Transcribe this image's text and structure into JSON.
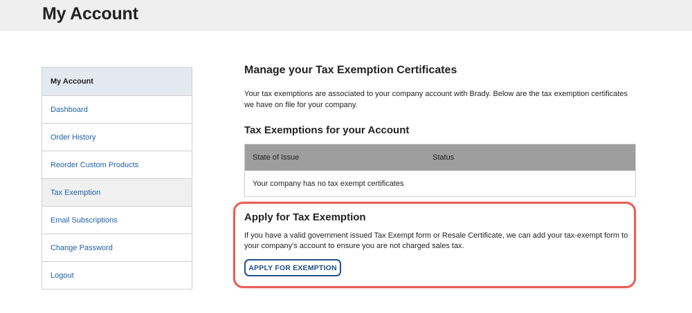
{
  "header": {
    "title": "My Account"
  },
  "sidebar": {
    "items": [
      {
        "label": "My Account"
      },
      {
        "label": "Dashboard"
      },
      {
        "label": "Order History"
      },
      {
        "label": "Reorder Custom Products"
      },
      {
        "label": "Tax Exemption"
      },
      {
        "label": "Email Subscriptions"
      },
      {
        "label": "Change Password"
      },
      {
        "label": "Logout"
      }
    ]
  },
  "main": {
    "heading": "Manage your Tax Exemption Certificates",
    "intro": "Your tax exemptions are associated to your company account with Brady. Below are the tax exemption certificates we have on file for your company.",
    "exemptions_heading": "Tax Exemptions for your Account",
    "table": {
      "columns": [
        "State of Issue",
        "Status"
      ],
      "empty_message": "Your company has no tax exempt certificates"
    },
    "apply": {
      "heading": "Apply for Tax Exemption",
      "text": "If you have a valid government issued Tax Exempt form or Resale Certificate, we can add your tax-exempt form to your company's account to ensure you are not charged sales tax.",
      "button_label": "APPLY FOR EXEMPTION"
    }
  },
  "colors": {
    "link": "#1f5fa8",
    "sidebar_header_bg": "#e3e9f1",
    "table_header_bg": "#9e9e9e",
    "highlight_border": "#e85f57",
    "button_border": "#1f4f91"
  }
}
